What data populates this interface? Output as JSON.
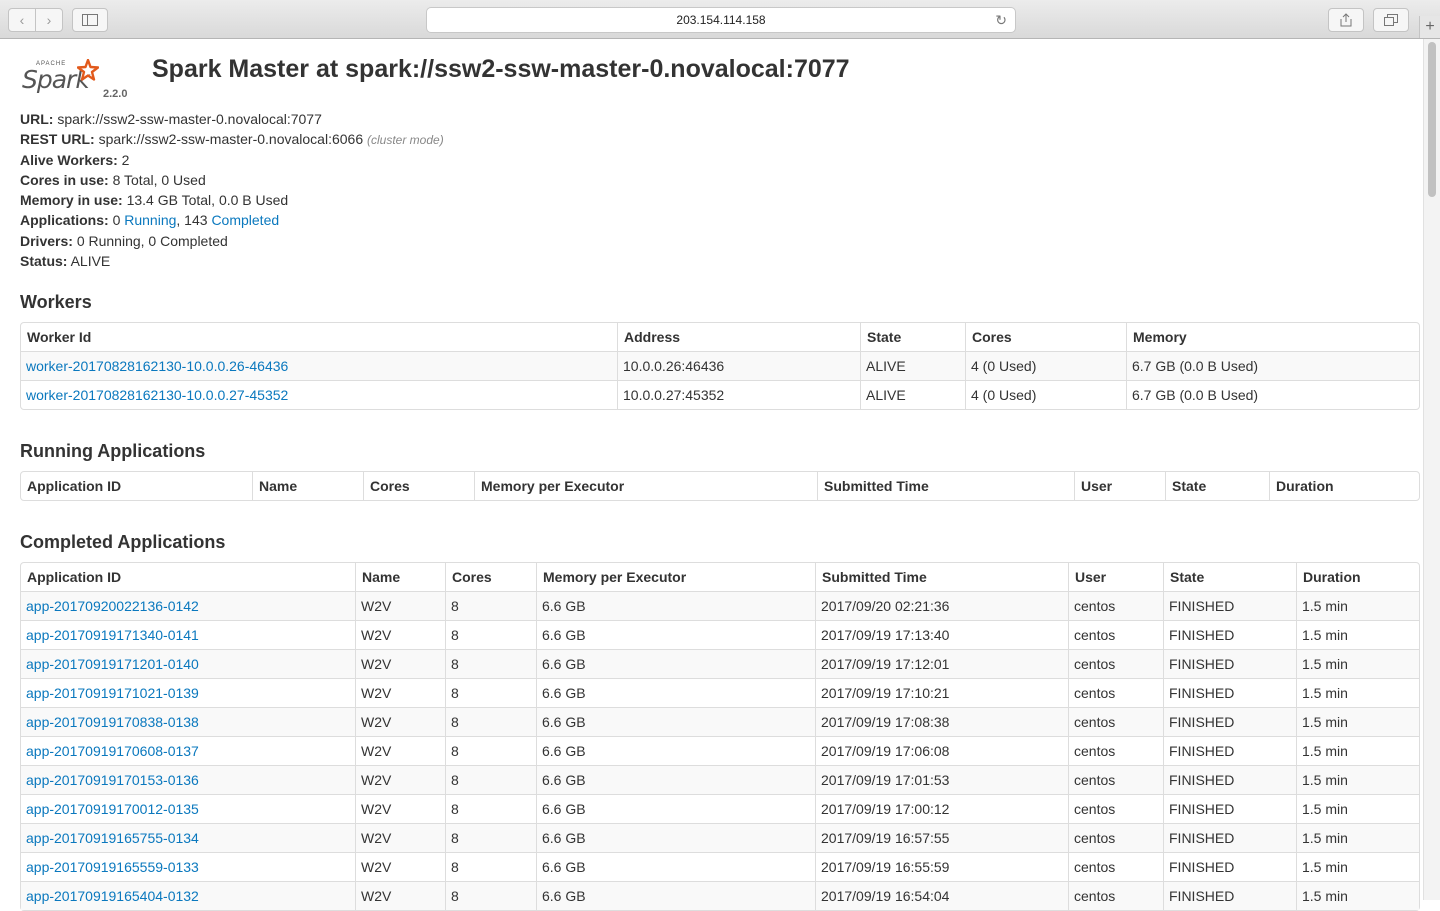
{
  "browser": {
    "url": "203.154.114.158"
  },
  "header": {
    "logo_word": "Spark",
    "logo_apache": "APACHE",
    "version": "2.2.0",
    "title": "Spark Master at spark://ssw2-ssw-master-0.novalocal:7077"
  },
  "info": {
    "url_label": "URL:",
    "url_value": "spark://ssw2-ssw-master-0.novalocal:7077",
    "rest_label": "REST URL:",
    "rest_value": "spark://ssw2-ssw-master-0.novalocal:6066",
    "rest_mode": "(cluster mode)",
    "alive_label": "Alive Workers:",
    "alive_value": "2",
    "cores_label": "Cores in use:",
    "cores_value": "8 Total, 0 Used",
    "memory_label": "Memory in use:",
    "memory_value": "13.4 GB Total, 0.0 B Used",
    "apps_label": "Applications:",
    "apps_running_count": "0",
    "apps_running_link": "Running",
    "apps_sep": ", 143",
    "apps_completed_link": "Completed",
    "drivers_label": "Drivers:",
    "drivers_value": "0 Running, 0 Completed",
    "status_label": "Status:",
    "status_value": "ALIVE"
  },
  "workers": {
    "heading": "Workers",
    "columns": [
      "Worker Id",
      "Address",
      "State",
      "Cores",
      "Memory"
    ],
    "rows": [
      [
        "worker-20170828162130-10.0.0.26-46436",
        "10.0.0.26:46436",
        "ALIVE",
        "4 (0 Used)",
        "6.7 GB (0.0 B Used)"
      ],
      [
        "worker-20170828162130-10.0.0.27-45352",
        "10.0.0.27:45352",
        "ALIVE",
        "4 (0 Used)",
        "6.7 GB (0.0 B Used)"
      ]
    ]
  },
  "running": {
    "heading": "Running Applications",
    "columns": [
      "Application ID",
      "Name",
      "Cores",
      "Memory per Executor",
      "Submitted Time",
      "User",
      "State",
      "Duration"
    ]
  },
  "completed": {
    "heading": "Completed Applications",
    "columns": [
      "Application ID",
      "Name",
      "Cores",
      "Memory per Executor",
      "Submitted Time",
      "User",
      "State",
      "Duration"
    ],
    "rows": [
      [
        "app-20170920022136-0142",
        "W2V",
        "8",
        "6.6 GB",
        "2017/09/20 02:21:36",
        "centos",
        "FINISHED",
        "1.5 min"
      ],
      [
        "app-20170919171340-0141",
        "W2V",
        "8",
        "6.6 GB",
        "2017/09/19 17:13:40",
        "centos",
        "FINISHED",
        "1.5 min"
      ],
      [
        "app-20170919171201-0140",
        "W2V",
        "8",
        "6.6 GB",
        "2017/09/19 17:12:01",
        "centos",
        "FINISHED",
        "1.5 min"
      ],
      [
        "app-20170919171021-0139",
        "W2V",
        "8",
        "6.6 GB",
        "2017/09/19 17:10:21",
        "centos",
        "FINISHED",
        "1.5 min"
      ],
      [
        "app-20170919170838-0138",
        "W2V",
        "8",
        "6.6 GB",
        "2017/09/19 17:08:38",
        "centos",
        "FINISHED",
        "1.5 min"
      ],
      [
        "app-20170919170608-0137",
        "W2V",
        "8",
        "6.6 GB",
        "2017/09/19 17:06:08",
        "centos",
        "FINISHED",
        "1.5 min"
      ],
      [
        "app-20170919170153-0136",
        "W2V",
        "8",
        "6.6 GB",
        "2017/09/19 17:01:53",
        "centos",
        "FINISHED",
        "1.5 min"
      ],
      [
        "app-20170919170012-0135",
        "W2V",
        "8",
        "6.6 GB",
        "2017/09/19 17:00:12",
        "centos",
        "FINISHED",
        "1.5 min"
      ],
      [
        "app-20170919165755-0134",
        "W2V",
        "8",
        "6.6 GB",
        "2017/09/19 16:57:55",
        "centos",
        "FINISHED",
        "1.5 min"
      ],
      [
        "app-20170919165559-0133",
        "W2V",
        "8",
        "6.6 GB",
        "2017/09/19 16:55:59",
        "centos",
        "FINISHED",
        "1.5 min"
      ],
      [
        "app-20170919165404-0132",
        "W2V",
        "8",
        "6.6 GB",
        "2017/09/19 16:54:04",
        "centos",
        "FINISHED",
        "1.5 min"
      ]
    ]
  },
  "colors": {
    "link": "#0a78be",
    "logo_star": "#e25a1c"
  }
}
